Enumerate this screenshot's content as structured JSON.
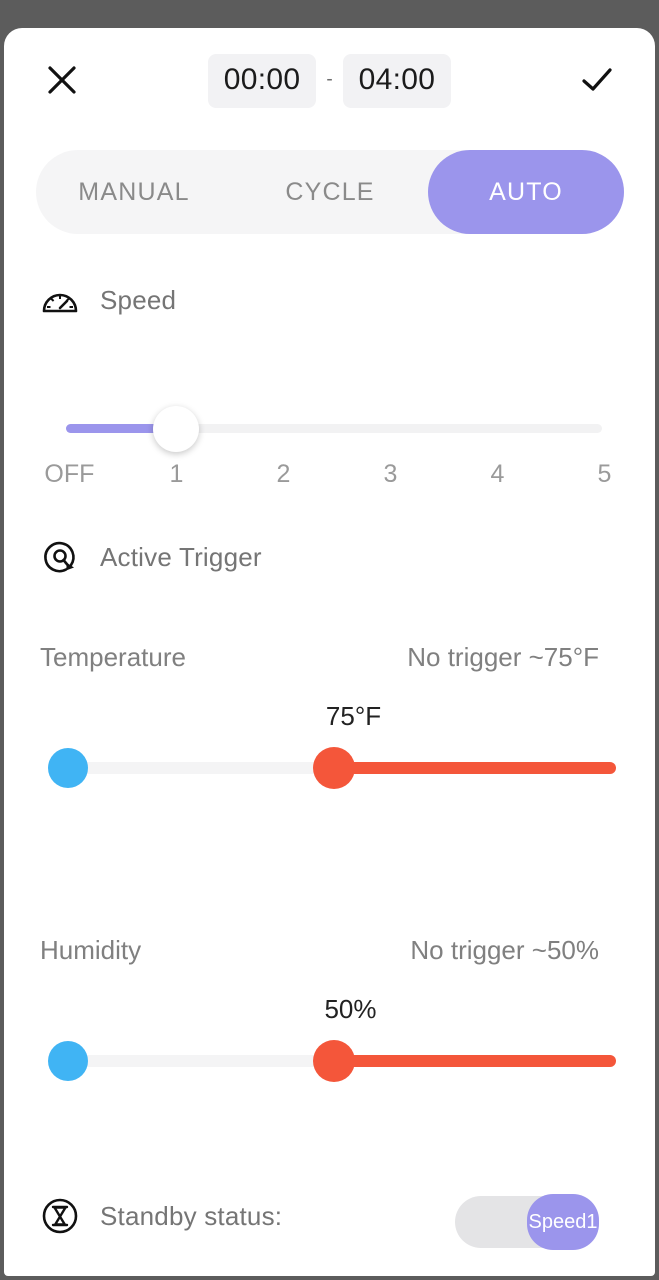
{
  "header": {
    "close_icon": "close-x-icon",
    "confirm_icon": "check-icon",
    "start_time": "00:00",
    "separator": "-",
    "end_time": "04:00"
  },
  "mode_tabs": [
    {
      "label": "MANUAL",
      "active": false
    },
    {
      "label": "CYCLE",
      "active": false
    },
    {
      "label": "AUTO",
      "active": true
    }
  ],
  "speed": {
    "icon": "speedometer-icon",
    "label": "Speed",
    "ticks": [
      "OFF",
      "1",
      "2",
      "3",
      "4",
      "5"
    ],
    "value_index": 1
  },
  "active_trigger": {
    "icon": "target-refresh-icon",
    "label": "Active Trigger"
  },
  "temperature": {
    "label": "Temperature",
    "status": "No trigger ~75°F",
    "value_label": "75°F"
  },
  "humidity": {
    "label": "Humidity",
    "status": "No trigger ~50%",
    "value_label": "50%"
  },
  "standby": {
    "icon": "hourglass-circle-icon",
    "label": "Standby status:",
    "toggle_label": "Speed1"
  },
  "colors": {
    "accent_purple": "#9b95ec",
    "thumb_blue": "#40b4f4",
    "thumb_red": "#f4563a",
    "backdrop": "#5c5c5c"
  }
}
